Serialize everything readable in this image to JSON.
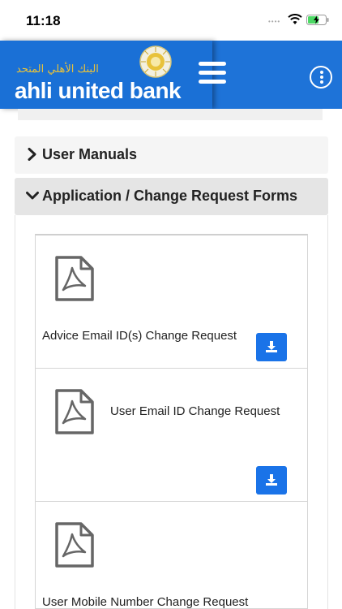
{
  "status_bar": {
    "time": "11:18",
    "signal_dots": "••••"
  },
  "header": {
    "logo_arabic": "البنك الأهلي المتحد",
    "logo_english": "ahli united bank",
    "brand_color": "#1e73d8",
    "logo_gold": "#e8c23a"
  },
  "sections": [
    {
      "label": "User Manuals",
      "expanded": false
    },
    {
      "label": "Application / Change Request Forms",
      "expanded": true
    }
  ],
  "documents": [
    {
      "title": "Advice Email ID(s) Change Request",
      "icon": "pdf-icon",
      "action_icon": "download-icon"
    },
    {
      "title": "User Email ID Change Request",
      "icon": "pdf-icon",
      "action_icon": "download-icon"
    },
    {
      "title": "User Mobile Number Change Request",
      "icon": "pdf-icon",
      "action_icon": "download-icon"
    }
  ],
  "colors": {
    "download_button": "#1a73e8",
    "section_active_bg": "#e5e5e5",
    "section_bg": "#f5f5f5"
  }
}
